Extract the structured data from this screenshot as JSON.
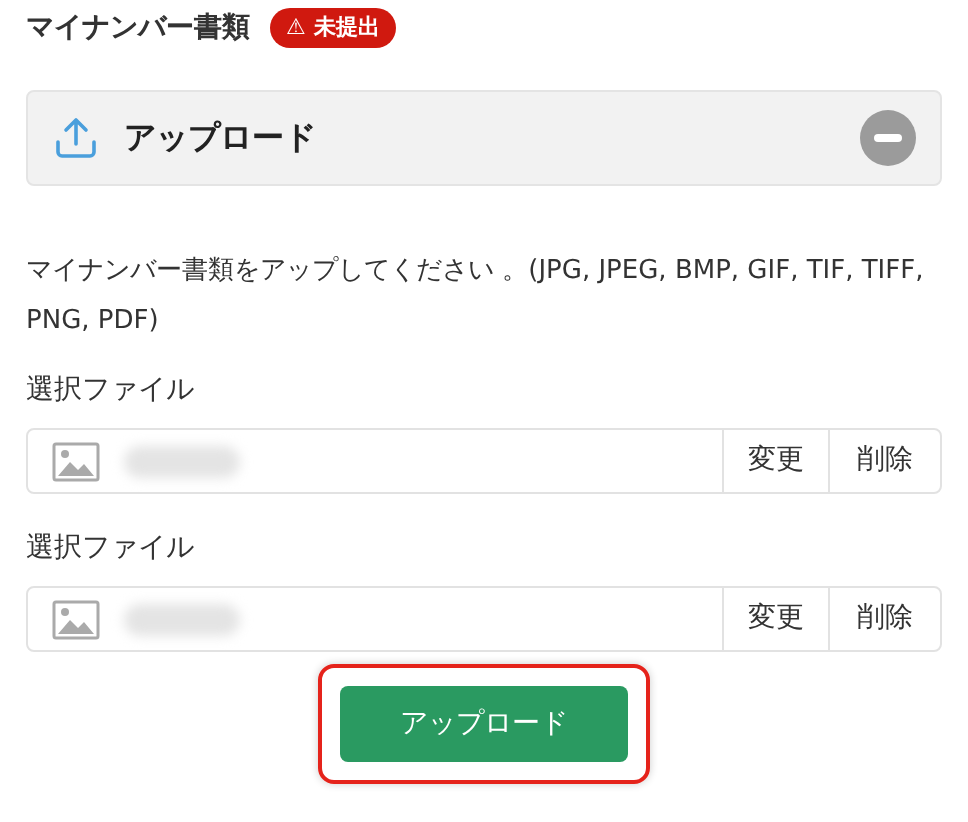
{
  "title": "マイナンバー書類",
  "status_badge": {
    "icon": "⚠",
    "label": "未提出"
  },
  "upload_panel": {
    "title": "アップロード",
    "expanded": true
  },
  "description": "マイナンバー書類をアップしてください 。(JPG, JPEG, BMP, GIF, TIF, TIFF, PNG, PDF)",
  "files": [
    {
      "label": "選択ファイル",
      "change": "変更",
      "delete": "削除"
    },
    {
      "label": "選択ファイル",
      "change": "変更",
      "delete": "削除"
    }
  ],
  "submit": {
    "label": "アップロード",
    "highlighted": true
  }
}
